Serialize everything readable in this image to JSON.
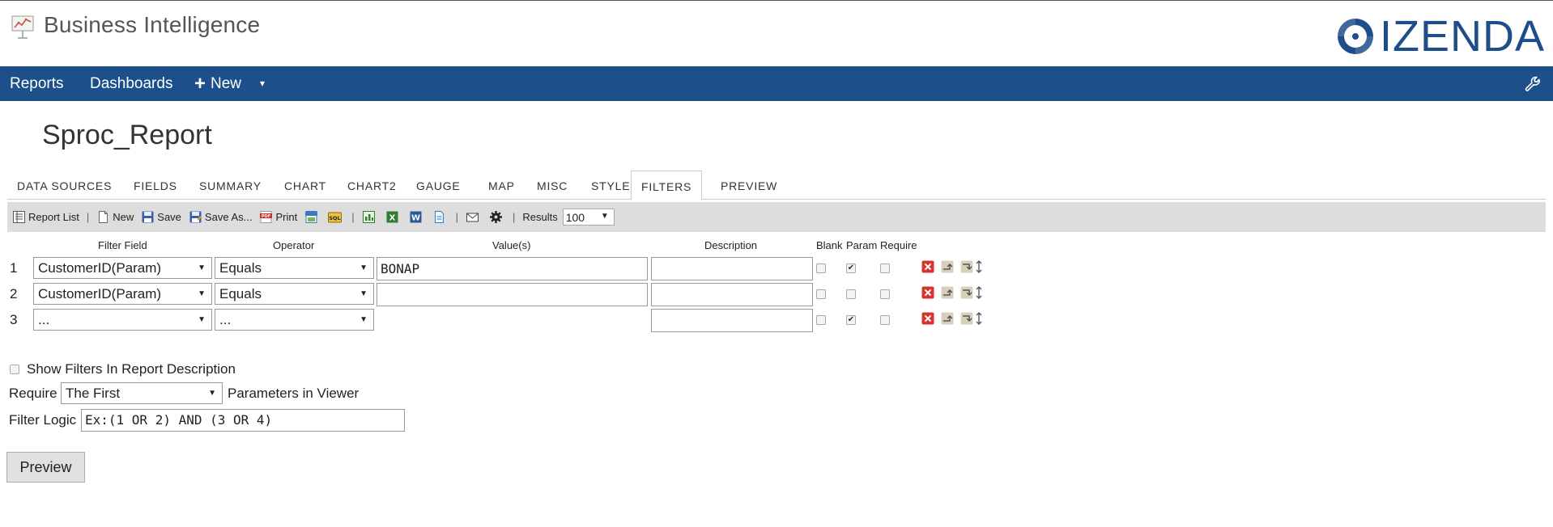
{
  "header": {
    "app_title": "Business Intelligence",
    "brand": "IZENDA",
    "brand_color": "#1d4e8a"
  },
  "navbar": {
    "color": "#1d4f8b",
    "reports": "Reports",
    "dashboards": "Dashboards",
    "new": "New",
    "plus_icon": "+",
    "caret": "▾"
  },
  "report": {
    "title": "Sproc_Report"
  },
  "tabs": [
    "DATA SOURCES",
    "FIELDS",
    "SUMMARY",
    "CHART",
    "CHART2",
    "GAUGE",
    "MAP",
    "MISC",
    "STYLE",
    "FILTERS",
    "PREVIEW"
  ],
  "active_tab": "FILTERS",
  "toolbar": {
    "report_list": "Report List",
    "sep": "|",
    "new": "New",
    "save": "Save",
    "save_as": "Save As...",
    "print": "Print",
    "results_label": "Results",
    "results_value": "100"
  },
  "filters": {
    "headers": {
      "filter_field": "Filter Field",
      "operator": "Operator",
      "values": "Value(s)",
      "description": "Description",
      "blank": "Blank",
      "param": "Param",
      "require": "Require"
    },
    "rows": [
      {
        "num": "1",
        "field": "CustomerID(Param)",
        "operator": "Equals",
        "value": "BONAP",
        "description": "",
        "blank": false,
        "param": true,
        "require": false
      },
      {
        "num": "2",
        "field": "CustomerID(Param)",
        "operator": "Equals",
        "value": "",
        "description": "",
        "blank": false,
        "param": false,
        "require": false
      },
      {
        "num": "3",
        "field": "...",
        "operator": "...",
        "value": "",
        "description": "",
        "blank": false,
        "param": true,
        "require": false
      }
    ]
  },
  "options": {
    "show_filters_label": "Show Filters In Report Description",
    "require_label": "Require",
    "require_value": "The First",
    "parameters_label": "Parameters in Viewer",
    "filter_logic_label": "Filter Logic",
    "filter_logic_value": "Ex:(1 OR 2) AND (3 OR 4)"
  },
  "preview_button": "Preview"
}
